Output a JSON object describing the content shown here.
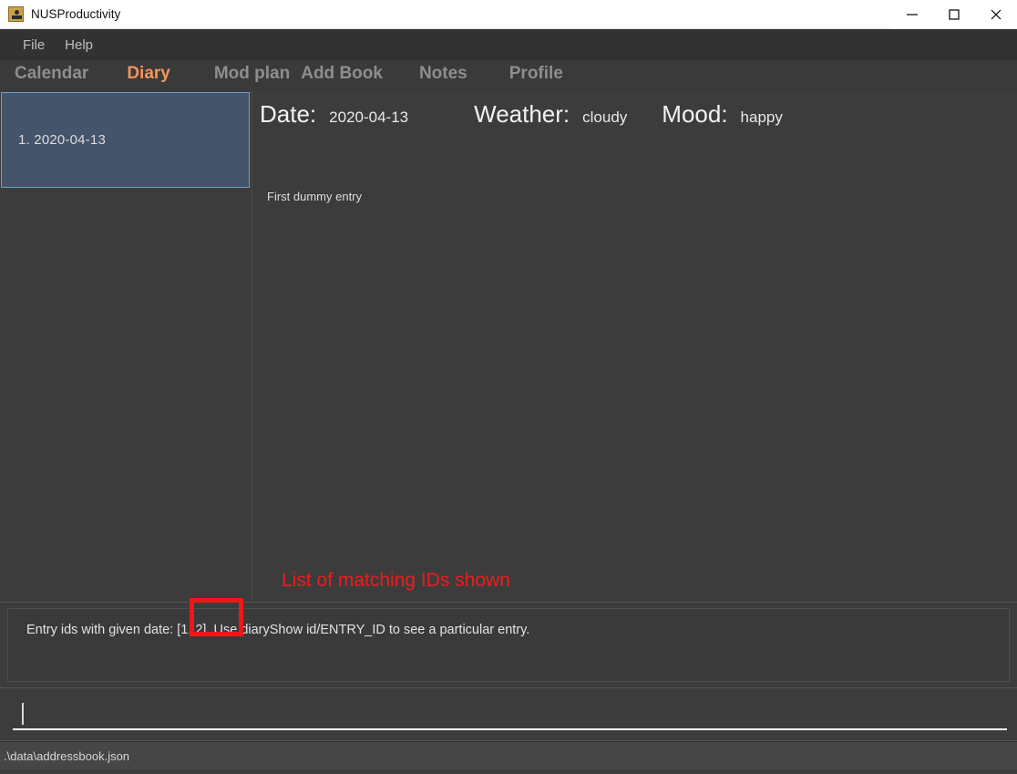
{
  "window": {
    "title": "NUSProductivity",
    "icon": "app-icon",
    "minimize_label": "–",
    "maximize_label": "□",
    "close_label": "✕"
  },
  "menubar": {
    "items": [
      {
        "label": "File"
      },
      {
        "label": "Help"
      }
    ]
  },
  "tabs": [
    {
      "label": "Calendar",
      "active": false
    },
    {
      "label": "Diary",
      "active": true
    },
    {
      "label": "Mod plan",
      "active": false
    },
    {
      "label": "Add Book",
      "active": false
    },
    {
      "label": "Notes",
      "active": false
    },
    {
      "label": "Profile",
      "active": false
    }
  ],
  "sidebar": {
    "entries": [
      {
        "index": "1.",
        "date": "2020-04-13",
        "display": "1.  2020-04-13",
        "selected": true
      }
    ]
  },
  "entry": {
    "date_label": "Date:",
    "date_value": "2020-04-13",
    "weather_label": "Weather:",
    "weather_value": "cloudy",
    "mood_label": "Mood:",
    "mood_value": "happy",
    "body": "First dummy entry"
  },
  "annotation": {
    "text": "List of matching IDs shown",
    "color": "#ee1c1c"
  },
  "result": {
    "text": "Entry ids with given date: [1, 2]. Use diaryShow id/ENTRY_ID to see a particular entry.",
    "highlighted_fragment": "[1, 2].",
    "highlight_color": "#f01717"
  },
  "command": {
    "value": "",
    "placeholder": ""
  },
  "statusbar": {
    "file_path": ".\\data\\addressbook.json"
  },
  "colors": {
    "app_background": "#3c3c3c",
    "menubar": "#323232",
    "tab_active": "#f4955c",
    "tab_inactive": "#8e8e8e",
    "selected_card": "#44546a",
    "selected_card_border": "#6fa0c4",
    "statusbar": "#464646"
  }
}
